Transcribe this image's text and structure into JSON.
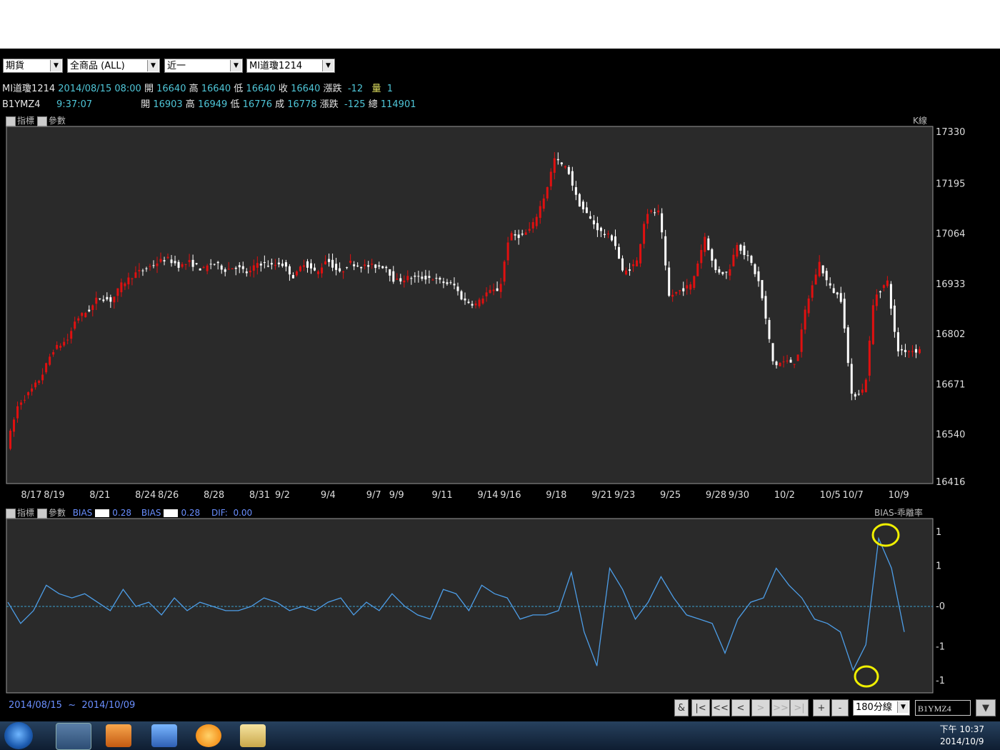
{
  "toolbar": {
    "market": "期貨",
    "product": "全商品 (ALL)",
    "month": "近一",
    "contract": "MI道瓊1214"
  },
  "quote1": {
    "symbol": "MI道瓊1214",
    "datetime": "2014/08/15 08:00",
    "open_label": "開",
    "open": "16640",
    "high_label": "高",
    "high": "16640",
    "low_label": "低",
    "low": "16640",
    "close_label": "收",
    "close": "16640",
    "chg_label": "漲跌",
    "chg": "-12",
    "vol_label": "量",
    "vol": "1"
  },
  "quote2": {
    "symbol": "B1YMZ4",
    "time": "9:37:07",
    "open_label": "開",
    "open": "16903",
    "high_label": "高",
    "high": "16949",
    "low_label": "低",
    "low": "16776",
    "close_label": "成",
    "close": "16778",
    "chg_label": "漲跌",
    "chg": "-125",
    "vol_label": "總",
    "vol": "114901"
  },
  "upper_panel": {
    "indicator_label": "指標",
    "param_label": "參數",
    "type_label": "K線"
  },
  "lower_panel": {
    "indicator_label": "指標",
    "param_label": "參數",
    "bias1_label": "BIAS",
    "bias1_value": "0.28",
    "bias2_label": "BIAS",
    "bias2_value": "0.28",
    "dif_label": "DIF:",
    "dif_value": "0.00",
    "type_label": "BIAS-乖離率"
  },
  "chart_data": [
    {
      "type": "candlestick",
      "title": "",
      "y_ticks": [
        17330,
        17195,
        17064,
        16933,
        16802,
        16671,
        16540,
        16416
      ],
      "ylim": [
        16416,
        17330
      ],
      "x_ticks": [
        "8/17",
        "8/19",
        "8/21",
        "8/24",
        "8/26",
        "8/28",
        "8/31",
        "9/2",
        "9/4",
        "9/7",
        "9/9",
        "9/11",
        "9/14",
        "9/16",
        "9/18",
        "9/21",
        "9/23",
        "9/25",
        "9/28",
        "9/30",
        "10/2",
        "10/5",
        "10/7",
        "10/9"
      ],
      "x_tick_pos": [
        1,
        2,
        4,
        6,
        7,
        9,
        11,
        12,
        14,
        16,
        17,
        19,
        21,
        22,
        24,
        26,
        27,
        29,
        31,
        32,
        34,
        36,
        37,
        39
      ],
      "x_range": [
        0,
        40
      ],
      "close_path": [
        [
          0,
          16510
        ],
        [
          0.5,
          16620
        ],
        [
          1,
          16650
        ],
        [
          1.5,
          16690
        ],
        [
          2,
          16760
        ],
        [
          2.7,
          16790
        ],
        [
          3,
          16840
        ],
        [
          3.7,
          16870
        ],
        [
          4,
          16900
        ],
        [
          4.6,
          16890
        ],
        [
          5,
          16930
        ],
        [
          5.6,
          16960
        ],
        [
          6,
          16970
        ],
        [
          6.6,
          16990
        ],
        [
          7,
          17000
        ],
        [
          7.6,
          16980
        ],
        [
          8,
          16990
        ],
        [
          8.6,
          16970
        ],
        [
          9,
          16990
        ],
        [
          9.6,
          16970
        ],
        [
          10,
          16980
        ],
        [
          10.6,
          16960
        ],
        [
          11,
          16990
        ],
        [
          11.6,
          16980
        ],
        [
          12,
          16990
        ],
        [
          12.6,
          16950
        ],
        [
          13,
          16990
        ],
        [
          13.6,
          16960
        ],
        [
          14,
          17000
        ],
        [
          14.6,
          16960
        ],
        [
          15,
          16990
        ],
        [
          15.6,
          16980
        ],
        [
          16,
          16980
        ],
        [
          16.6,
          16980
        ],
        [
          17,
          16940
        ],
        [
          17.6,
          16950
        ],
        [
          18,
          16950
        ],
        [
          18.6,
          16950
        ],
        [
          19,
          16940
        ],
        [
          19.6,
          16930
        ],
        [
          20,
          16890
        ],
        [
          20.6,
          16880
        ],
        [
          21,
          16910
        ],
        [
          21.6,
          16920
        ],
        [
          22,
          17060
        ],
        [
          22.6,
          17060
        ],
        [
          23,
          17080
        ],
        [
          23.6,
          17170
        ],
        [
          24,
          17260
        ],
        [
          24.6,
          17230
        ],
        [
          25,
          17150
        ],
        [
          25.6,
          17100
        ],
        [
          26,
          17070
        ],
        [
          26.6,
          17050
        ],
        [
          27,
          16960
        ],
        [
          27.6,
          16990
        ],
        [
          28,
          17120
        ],
        [
          28.6,
          17120
        ],
        [
          29,
          16900
        ],
        [
          29.6,
          16920
        ],
        [
          30,
          16930
        ],
        [
          30.6,
          17060
        ],
        [
          31,
          16970
        ],
        [
          31.6,
          16960
        ],
        [
          32,
          17040
        ],
        [
          32.6,
          16990
        ],
        [
          33,
          16930
        ],
        [
          33.6,
          16720
        ],
        [
          34,
          16730
        ],
        [
          34.6,
          16730
        ],
        [
          35,
          16870
        ],
        [
          35.6,
          16990
        ],
        [
          36,
          16930
        ],
        [
          36.6,
          16890
        ],
        [
          37,
          16640
        ],
        [
          37.6,
          16660
        ],
        [
          38,
          16900
        ],
        [
          38.6,
          16940
        ],
        [
          39,
          16760
        ]
      ]
    },
    {
      "type": "line",
      "title": "",
      "y_ticks": [
        "1",
        "1",
        "-0",
        "-1",
        "-1"
      ],
      "ylim": [
        -1.9,
        1.9
      ],
      "values": [
        0.1,
        -0.4,
        -0.1,
        0.5,
        0.3,
        0.2,
        0.3,
        0.1,
        -0.1,
        0.4,
        0,
        0.1,
        -0.2,
        0.2,
        -0.1,
        0.1,
        0,
        -0.1,
        -0.1,
        0,
        0.2,
        0.1,
        -0.1,
        0,
        -0.1,
        0.1,
        0.2,
        -0.2,
        0.1,
        -0.1,
        0.3,
        0,
        -0.2,
        -0.3,
        0.4,
        0.3,
        -0.1,
        0.5,
        0.3,
        0.2,
        -0.3,
        -0.2,
        -0.2,
        -0.1,
        0.8,
        -0.6,
        -1.4,
        0.9,
        0.4,
        -0.3,
        0.1,
        0.7,
        0.2,
        -0.2,
        -0.3,
        -0.4,
        -1.1,
        -0.3,
        0.1,
        0.2,
        0.9,
        0.5,
        0.2,
        -0.3,
        -0.4,
        -0.6,
        -1.5,
        -0.9,
        1.6,
        0.9,
        -0.6
      ]
    }
  ]
}
